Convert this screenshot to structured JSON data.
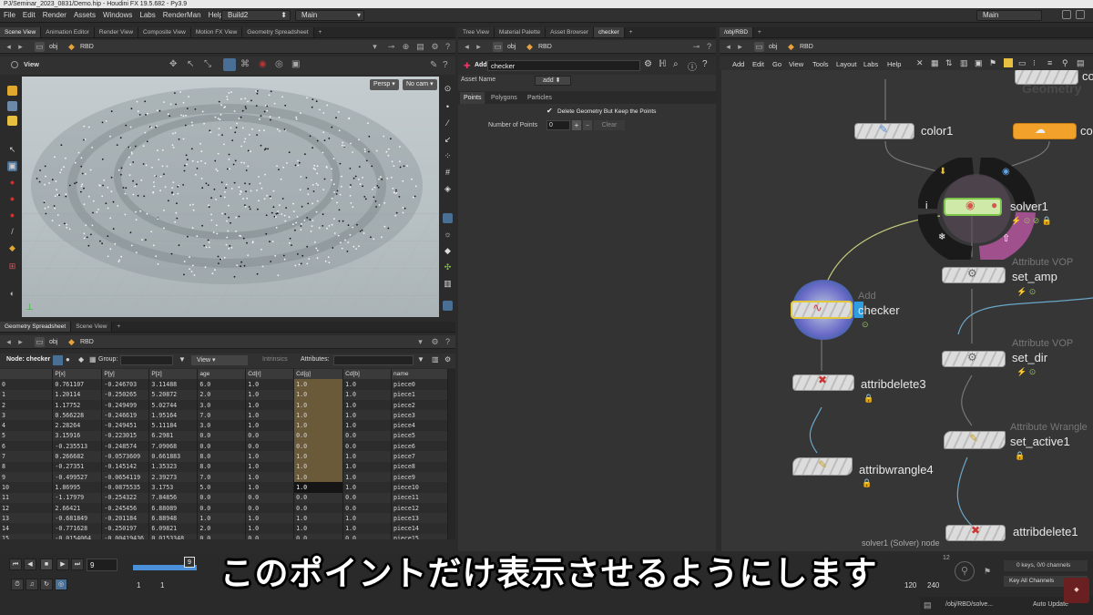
{
  "titlebar": {
    "text": "PJ/Seminar_2023_0831/Demo.hip - Houdini FX 19.5.682 - Py3.9"
  },
  "menubar": {
    "items": [
      "File",
      "Edit",
      "Render",
      "Assets",
      "Windows",
      "Labs",
      "RenderMan",
      "Help"
    ],
    "desktop": "Build2",
    "context": "Main",
    "context_right": "Main"
  },
  "left": {
    "tabs": [
      "Scene View",
      "Animation Editor",
      "Render View",
      "Composite View",
      "Motion FX View",
      "Geometry Spreadsheet"
    ],
    "path_obj": "obj",
    "path_rbd": "RBD",
    "view_label": "View",
    "persp": "Persp",
    "cam": "No cam"
  },
  "spreadsheet": {
    "tabs": [
      "Geometry Spreadsheet",
      "Scene View"
    ],
    "path_obj": "obj",
    "path_rbd": "RBD",
    "node_label": "Node: checker",
    "group_label": "Group:",
    "view_label": "View",
    "intrinsics_label": "Intrinsics",
    "attributes_label": "Attributes:",
    "columns": [
      "",
      "P[x]",
      "P[y]",
      "P[z]",
      "age",
      "Cd[r]",
      "Cd[g]",
      "Cd[b]",
      "name"
    ],
    "rows": [
      [
        "0",
        "0.761107",
        "-0.246703",
        "3.11488",
        "6.0",
        "1.0",
        "1.0",
        "1.0",
        "piece0"
      ],
      [
        "1",
        "1.20114",
        "-0.250265",
        "5.20872",
        "2.0",
        "1.0",
        "1.0",
        "1.0",
        "piece1"
      ],
      [
        "2",
        "1.17752",
        "-0.249499",
        "5.02744",
        "3.0",
        "1.0",
        "1.0",
        "1.0",
        "piece2"
      ],
      [
        "3",
        "0.566228",
        "-0.246619",
        "1.95164",
        "7.0",
        "1.0",
        "1.0",
        "1.0",
        "piece3"
      ],
      [
        "4",
        "2.28264",
        "-0.249451",
        "5.11184",
        "3.0",
        "1.0",
        "1.0",
        "1.0",
        "piece4"
      ],
      [
        "5",
        "3.15916",
        "-0.223015",
        "6.2981",
        "0.0",
        "0.0",
        "0.0",
        "0.0",
        "piece5"
      ],
      [
        "6",
        "-0.235513",
        "-0.248574",
        "7.09068",
        "0.0",
        "0.0",
        "0.0",
        "0.0",
        "piece6"
      ],
      [
        "7",
        "0.266682",
        "-0.0573609",
        "0.661883",
        "8.0",
        "1.0",
        "1.0",
        "1.0",
        "piece7"
      ],
      [
        "8",
        "-0.27351",
        "-0.145142",
        "1.35323",
        "8.0",
        "1.0",
        "1.0",
        "1.0",
        "piece8"
      ],
      [
        "9",
        "-0.499527",
        "-0.0654119",
        "2.39273",
        "7.0",
        "1.0",
        "1.0",
        "1.0",
        "piece9"
      ],
      [
        "10",
        "1.86995",
        "-0.0875535",
        "3.1753",
        "5.0",
        "1.0",
        "1.0",
        "1.0",
        "piece10"
      ],
      [
        "11",
        "-1.17979",
        "-0.254322",
        "7.84856",
        "0.0",
        "0.0",
        "0.0",
        "0.0",
        "piece11"
      ],
      [
        "12",
        "2.66421",
        "-0.245456",
        "6.88089",
        "0.0",
        "0.0",
        "0.0",
        "0.0",
        "piece12"
      ],
      [
        "13",
        "-0.681849",
        "-0.201184",
        "6.88948",
        "1.0",
        "1.0",
        "1.0",
        "1.0",
        "piece13"
      ],
      [
        "14",
        "-0.771628",
        "-0.250197",
        "6.09821",
        "2.0",
        "1.0",
        "1.0",
        "1.0",
        "piece14"
      ],
      [
        "15",
        "-0.0154064",
        "-0.00419436",
        "0.0153348",
        "0.0",
        "0.0",
        "0.0",
        "0.0",
        "piece15"
      ]
    ]
  },
  "middle": {
    "tabs": [
      "Tree View",
      "Material Palette",
      "Asset Browser",
      "checker"
    ],
    "path_obj": "obj",
    "path_rbd": "RBD",
    "node_type": "Add",
    "node_name": "checker",
    "asset_name_label": "Asset Name",
    "asset_name_value": "add",
    "subtabs": [
      "Points",
      "Polygons",
      "Particles"
    ],
    "delete_geo_label": "Delete Geometry But Keep the Points",
    "num_points_label": "Number of Points",
    "num_points_value": "0",
    "clear_label": "Clear"
  },
  "right": {
    "tab": "/obj/RBD",
    "path_obj": "obj",
    "path_rbd": "RBD",
    "menu": [
      "Add",
      "Edit",
      "Go",
      "View",
      "Tools",
      "Layout",
      "Labs",
      "Help"
    ],
    "watermark": "Geometry",
    "nodes": {
      "color1": "color1",
      "co_top": "co",
      "co_right": "co",
      "solver1": "solver1",
      "set_amp_type": "Attribute VOP",
      "set_amp": "set_amp",
      "checker_type": "Add",
      "checker": "checker",
      "set_dir_type": "Attribute VOP",
      "set_dir": "set_dir",
      "attribdelete3": "attribdelete3",
      "set_active_type": "Attribute Wrangle",
      "set_active1": "set_active1",
      "attribwrangle4": "attribwrangle4",
      "attribdelete1": "attribdelete1"
    },
    "status": "solver1 (Solver) node"
  },
  "timeline": {
    "frame": "9",
    "frame_marker": "9",
    "start": "1",
    "start2": "1",
    "tick_12": "12",
    "end1": "120",
    "end2": "240",
    "keys": "0 keys, 0/0 channels",
    "key_all": "Key All Channels",
    "path": "/obj/RBD/solve...",
    "auto_update": "Auto Update"
  },
  "subtitle": "このポイントだけ表示させるようにします",
  "colors": {
    "accent_blue": "#4a90d9",
    "orange_node": "#f2a12a",
    "solver_green": "#cfe9a8",
    "highlight_col": "#6b5a3a"
  }
}
